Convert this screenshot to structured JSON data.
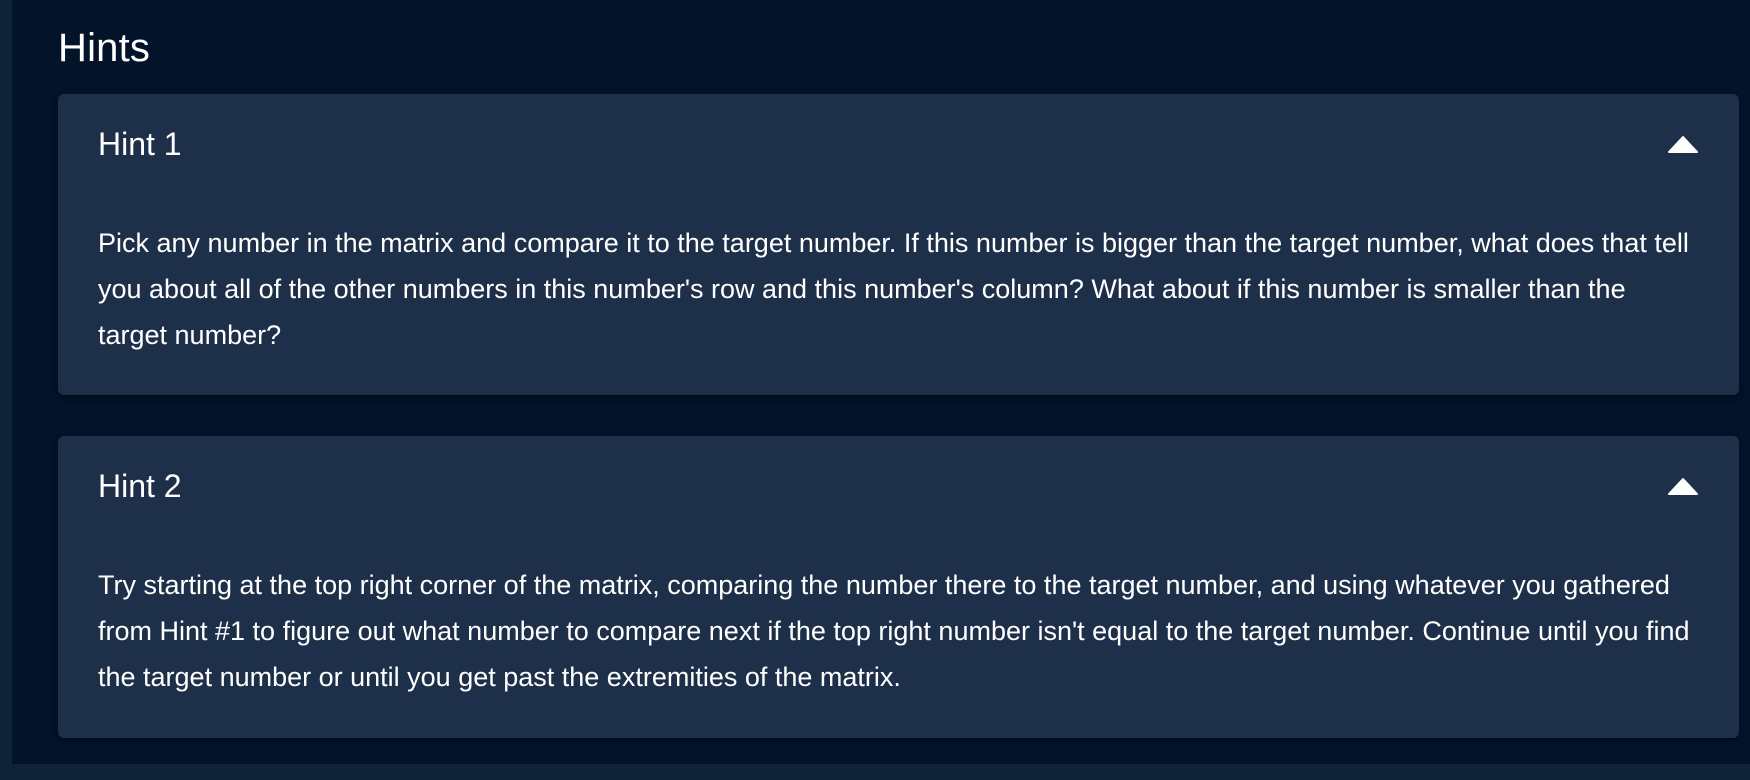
{
  "section": {
    "title": "Hints"
  },
  "hints": [
    {
      "label": "Hint 1",
      "expanded": true,
      "toggle_icon": "caret-up-icon",
      "body": "Pick any number in the matrix and compare it to the target number. If this number is bigger than the target number, what does that tell you about all of the other numbers in this number's row and this number's column? What about if this number is smaller than the target number?"
    },
    {
      "label": "Hint 2",
      "expanded": true,
      "toggle_icon": "caret-up-icon",
      "body": "Try starting at the top right corner of the matrix, comparing the number there to the target number, and using whatever you gathered from Hint #1 to figure out what number to compare next if the top right number isn't equal to the target number. Continue until you find the target number or until you get past the extremities of the matrix."
    }
  ],
  "colors": {
    "page_background": "#02132a",
    "card_background": "#1e3049",
    "text": "#ffffff"
  }
}
